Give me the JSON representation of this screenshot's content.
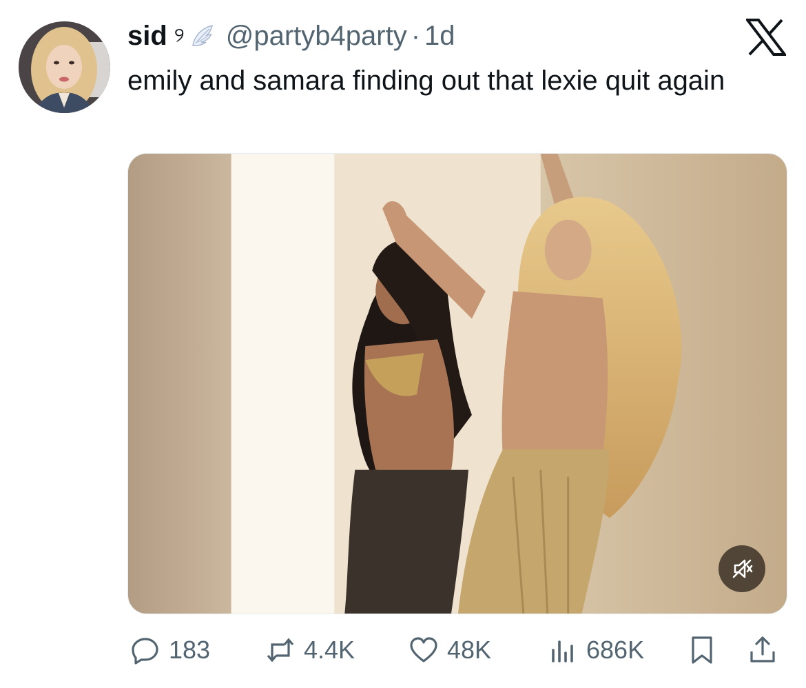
{
  "tweet": {
    "display_name": "sid",
    "name_emoji": "୨",
    "handle": "@partyb4party",
    "separator": "·",
    "age": "1d",
    "text": "emily and samara finding out that lexie quit again"
  },
  "actions": {
    "replies": "183",
    "reposts": "4.4K",
    "likes": "48K",
    "views": "686K"
  },
  "icons": {
    "avatar": "avatar",
    "wing": "wing-emoji-icon",
    "logo": "x-logo-icon",
    "mute": "muted-speaker-icon",
    "reply": "reply-icon",
    "repost": "repost-icon",
    "like": "heart-icon",
    "views": "views-icon",
    "bookmark": "bookmark-icon",
    "share": "share-icon"
  },
  "colors": {
    "text": "#0f1419",
    "secondary": "#536471",
    "background": "#ffffff"
  }
}
